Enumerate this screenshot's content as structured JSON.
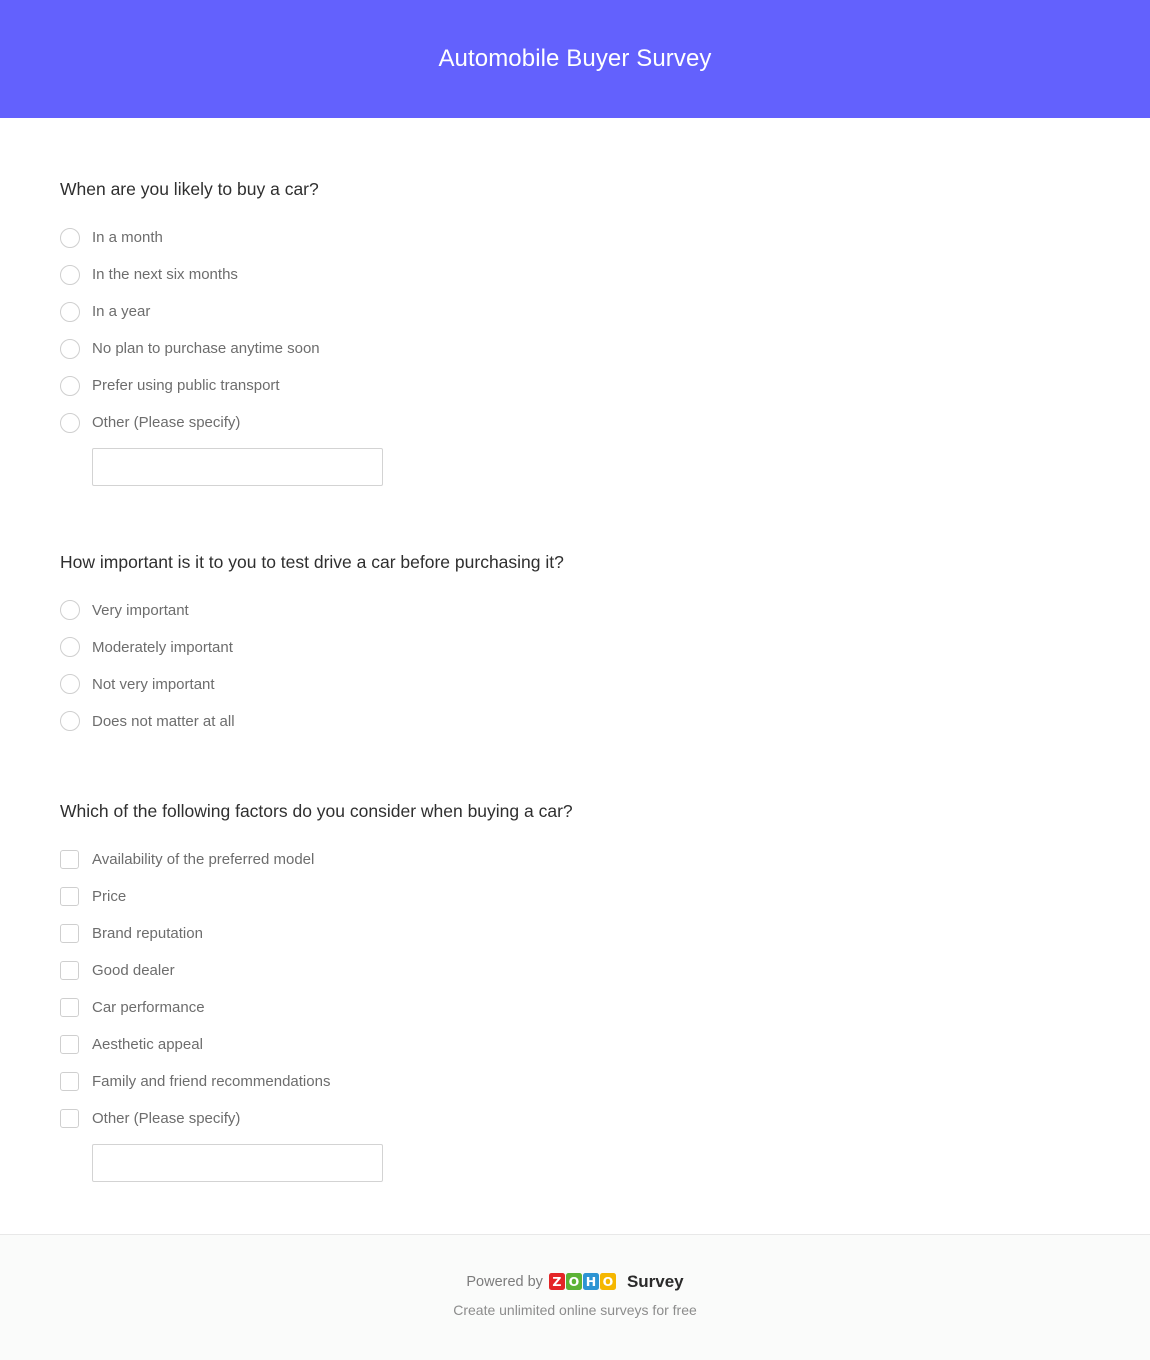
{
  "header": {
    "title": "Automobile Buyer Survey",
    "background_color": "#6361fd",
    "title_color": "#ffffff"
  },
  "questions": [
    {
      "id": "q1",
      "title": "When are you likely to buy a car?",
      "input_type": "radio",
      "options": [
        {
          "label": "In a month"
        },
        {
          "label": "In the next six months"
        },
        {
          "label": "In a year"
        },
        {
          "label": "No plan to purchase anytime soon"
        },
        {
          "label": "Prefer using public transport"
        },
        {
          "label": "Other (Please specify)"
        }
      ],
      "other_input": {
        "value": "",
        "placeholder": ""
      }
    },
    {
      "id": "q2",
      "title": "How important is it to you to test drive a car before purchasing it?",
      "input_type": "radio",
      "options": [
        {
          "label": "Very important"
        },
        {
          "label": "Moderately important"
        },
        {
          "label": "Not very important"
        },
        {
          "label": "Does not matter at all"
        }
      ]
    },
    {
      "id": "q3",
      "title": "Which of the following factors do you consider when buying a car?",
      "input_type": "checkbox",
      "options": [
        {
          "label": "Availability of the preferred model"
        },
        {
          "label": "Price"
        },
        {
          "label": "Brand reputation"
        },
        {
          "label": "Good dealer"
        },
        {
          "label": "Car performance"
        },
        {
          "label": "Aesthetic appeal"
        },
        {
          "label": "Family and friend recommendations"
        },
        {
          "label": "Other (Please specify)"
        }
      ],
      "other_input": {
        "value": "",
        "placeholder": ""
      }
    }
  ],
  "footer": {
    "powered_by": "Powered by",
    "brand_logo_letters": [
      "Z",
      "O",
      "H",
      "O"
    ],
    "brand_logo_colors": [
      "#e42527",
      "#5cb335",
      "#2c94d3",
      "#f5b700"
    ],
    "brand_product": "Survey",
    "tagline": "Create unlimited online surveys for free",
    "background_color": "#fafbfa"
  }
}
